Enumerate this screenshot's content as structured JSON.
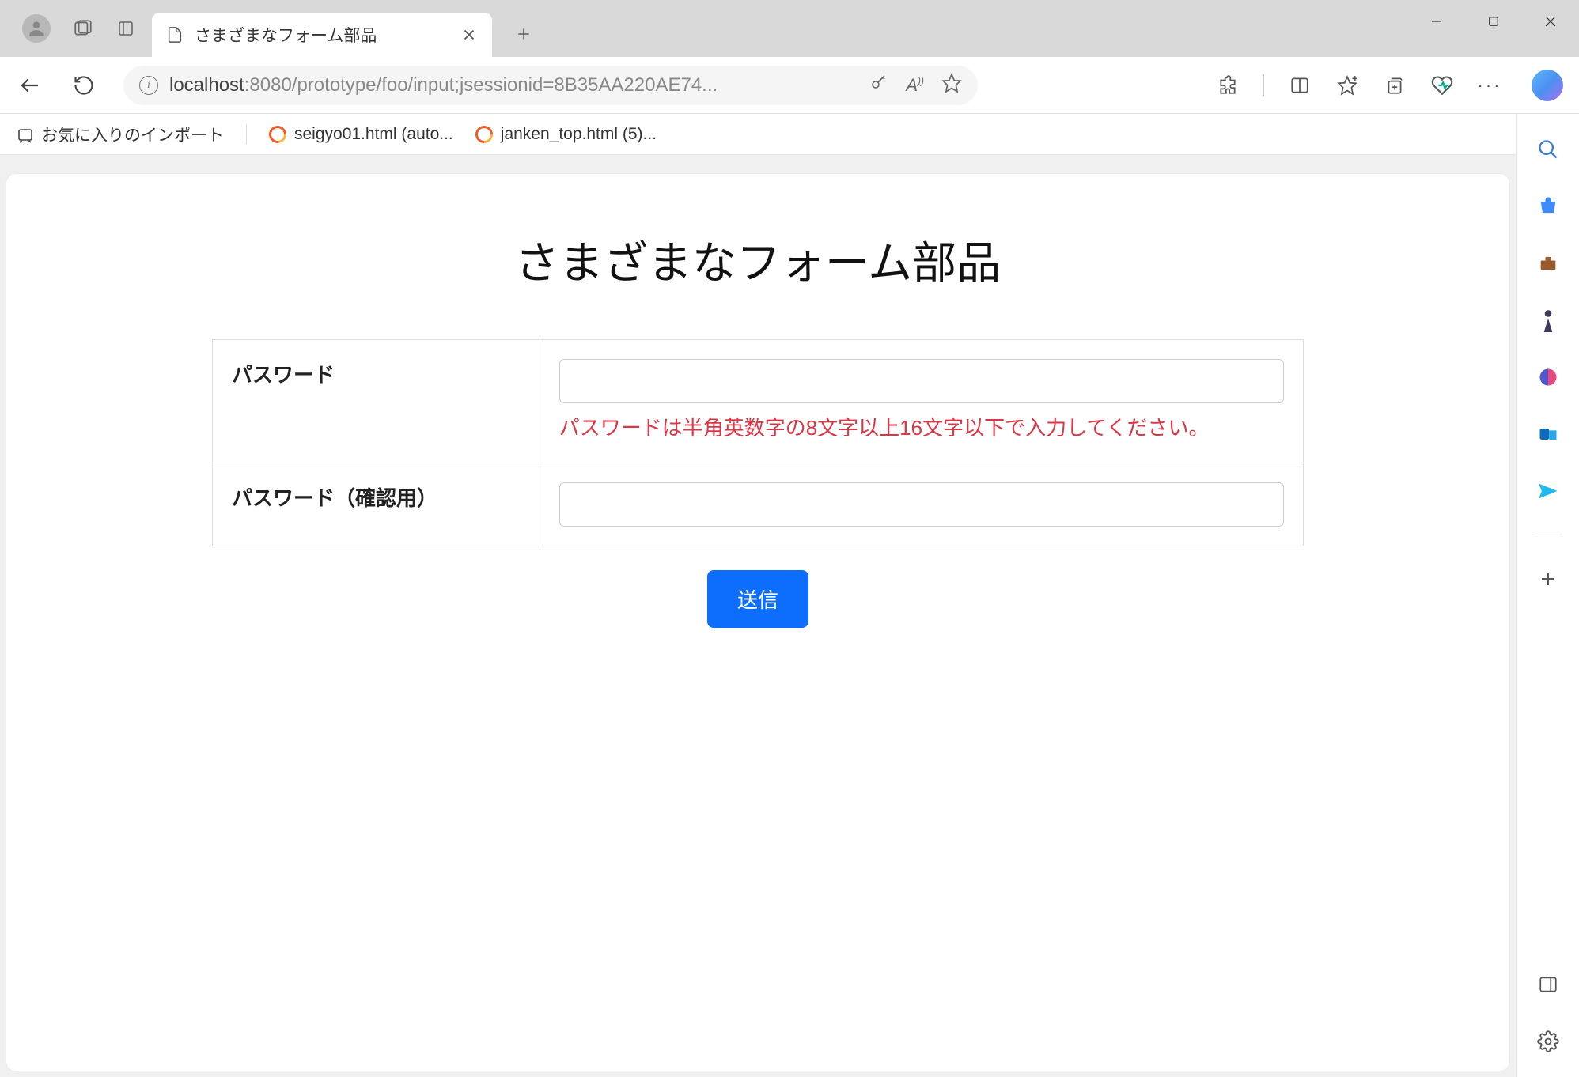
{
  "browser": {
    "tab_title": "さまざまなフォーム部品",
    "url_display": ":8080/prototype/foo/input;jsessionid=8B35AA220AE74...",
    "url_host": "localhost"
  },
  "bookmarks": {
    "import_label": "お気に入りのインポート",
    "items": [
      "seigyo01.html (auto...",
      "janken_top.html (5)..."
    ]
  },
  "page": {
    "title": "さまざまなフォーム部品",
    "rows": {
      "password_label": "パスワード",
      "password_error": "パスワードは半角英数字の8文字以上16文字以下で入力してください。",
      "password_confirm_label": "パスワード（確認用）"
    },
    "submit_label": "送信"
  }
}
